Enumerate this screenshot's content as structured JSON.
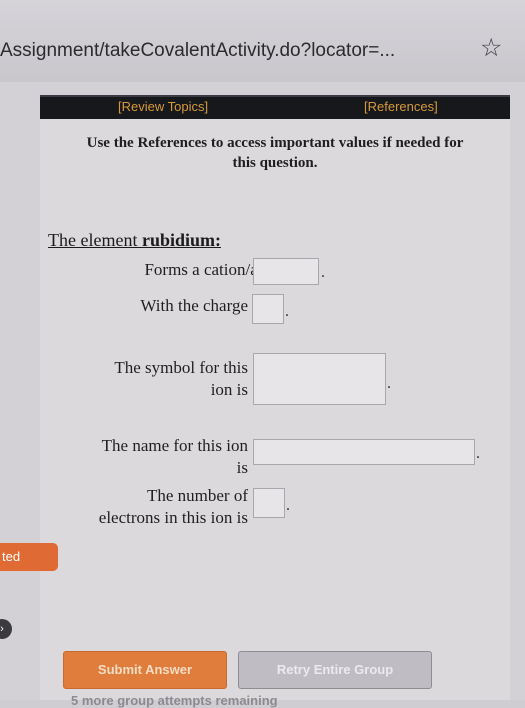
{
  "browser": {
    "url": "Assignment/takeCovalentActivity.do?locator=..."
  },
  "toolbar": {
    "review_topics": "[Review Topics]",
    "references": "[References]"
  },
  "instruction": {
    "line1": "Use the References to access important values if needed for",
    "line2": "this question."
  },
  "question": {
    "title_prefix": "The element ",
    "element": "rubidium:",
    "forms_label": "Forms a cation/anion",
    "charge_label": "With the charge",
    "symbol_label_1": "The symbol for this",
    "symbol_label_2": "ion is",
    "name_label_1": "The name for this ion",
    "name_label_2": "is",
    "electrons_label_1": "The number of",
    "electrons_label_2": "electrons in this ion is",
    "period": "."
  },
  "side": {
    "tab_text": "ted"
  },
  "actions": {
    "submit": "Submit Answer",
    "retry": "Retry Entire Group",
    "attempts": "5 more group attempts remaining"
  }
}
